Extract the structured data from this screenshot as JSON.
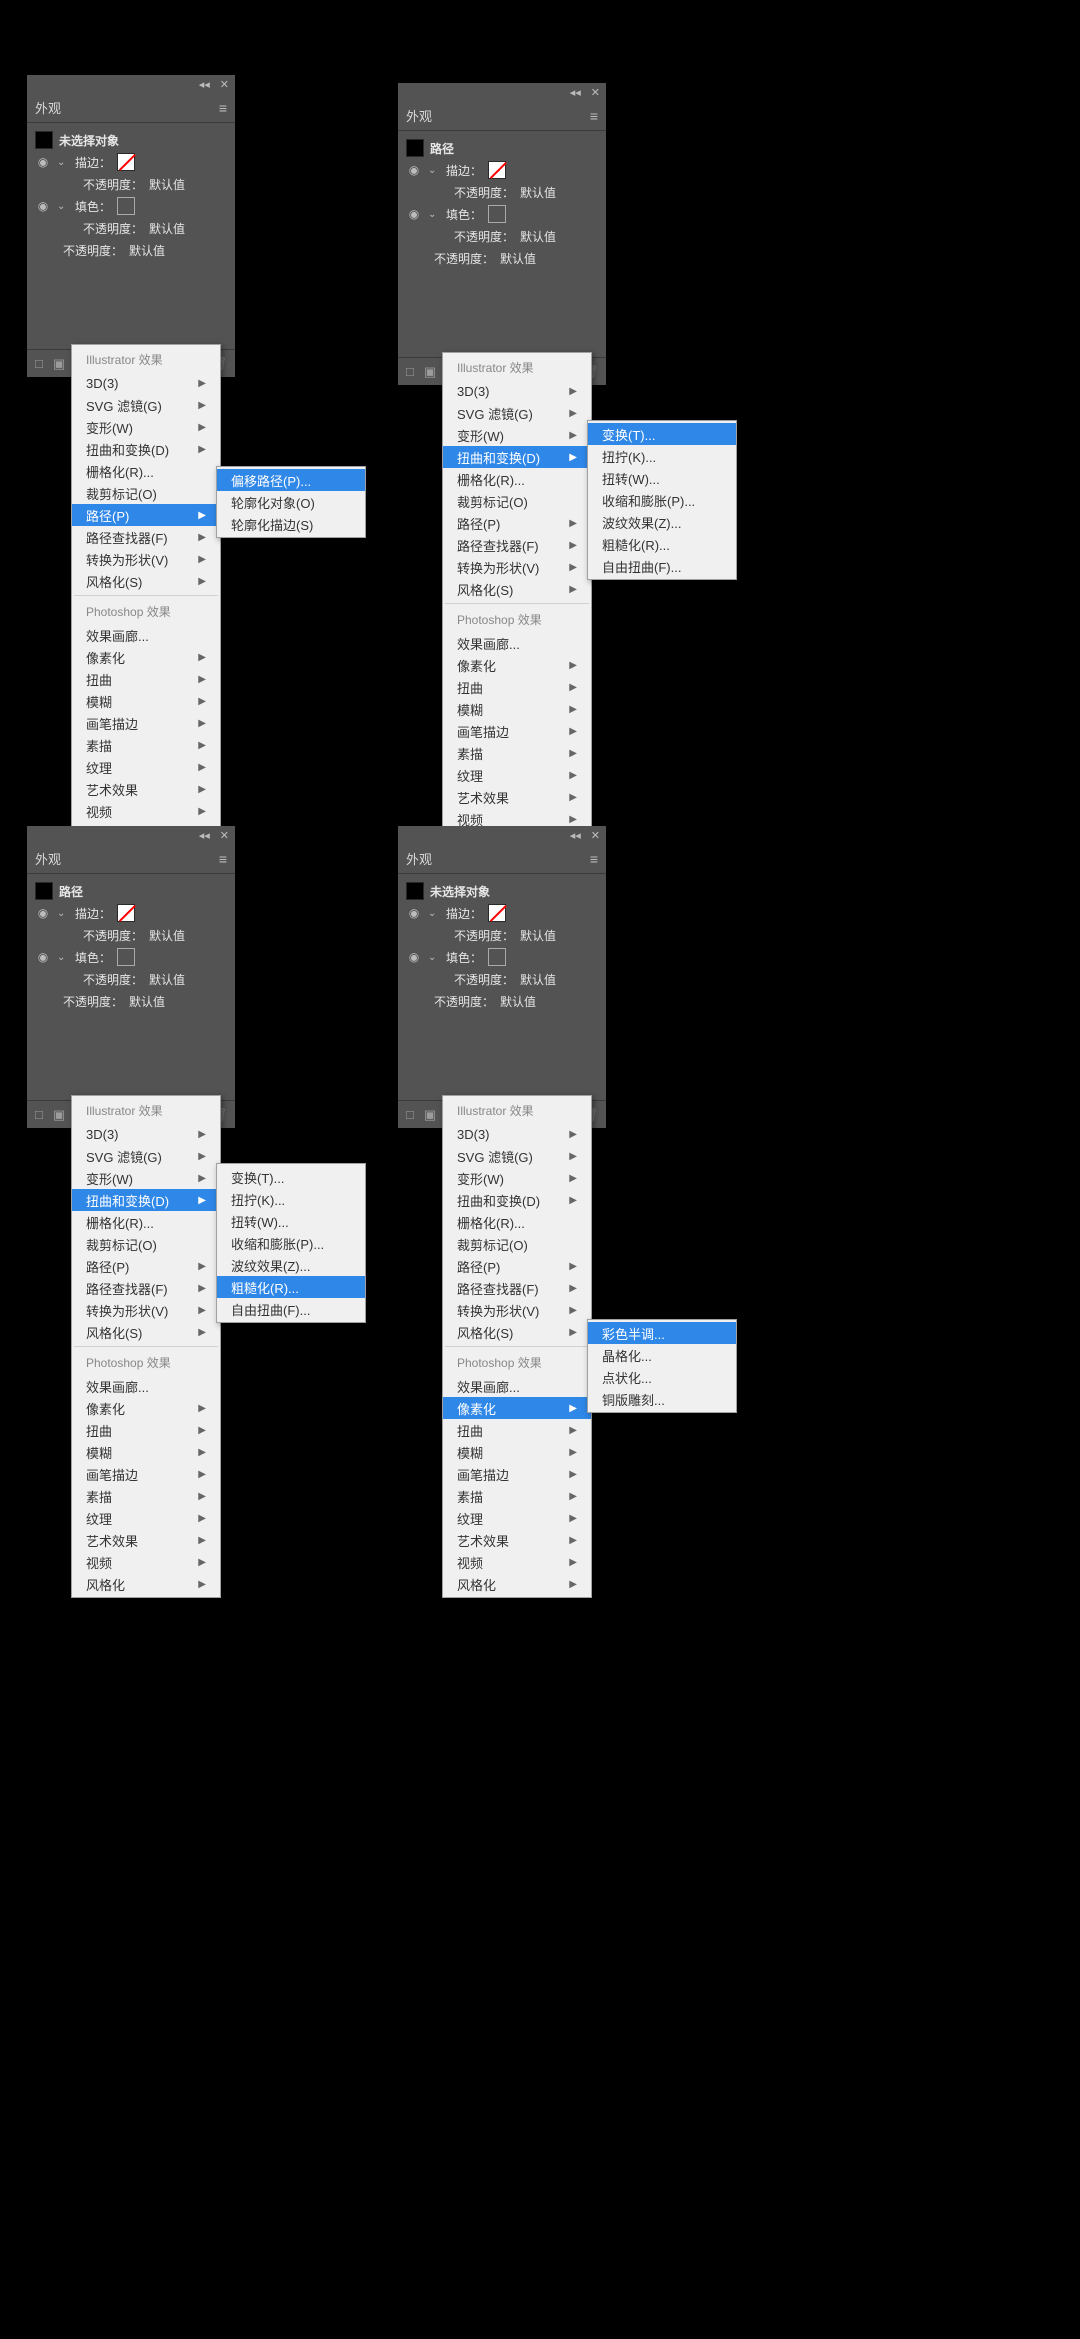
{
  "panels": {
    "p1": {
      "title": "外观",
      "selection": "未选择对象",
      "stroke_label": "描边：",
      "fill_label": "填色：",
      "opacity_label": "不透明度：",
      "default_value": "默认值"
    },
    "p2": {
      "title": "外观",
      "selection": "路径",
      "stroke_label": "描边：",
      "fill_label": "填色：",
      "opacity_label": "不透明度：",
      "default_value": "默认值"
    },
    "p3": {
      "title": "外观",
      "selection": "路径",
      "stroke_label": "描边：",
      "fill_label": "填色：",
      "opacity_label": "不透明度：",
      "default_value": "默认值"
    },
    "p4": {
      "title": "外观",
      "selection": "未选择对象",
      "stroke_label": "描边：",
      "fill_label": "填色：",
      "opacity_label": "不透明度：",
      "default_value": "默认值"
    }
  },
  "menu_sections": {
    "ill_heading": "Illustrator 效果",
    "ps_heading": "Photoshop 效果"
  },
  "ill_items_a": [
    {
      "label": "3D(3)",
      "arrow": true
    },
    {
      "label": "SVG 滤镜(G)",
      "arrow": true
    },
    {
      "label": "变形(W)",
      "arrow": true
    },
    {
      "label": "扭曲和变换(D)",
      "arrow": true
    },
    {
      "label": "栅格化(R)...",
      "arrow": false
    },
    {
      "label": "裁剪标记(O)",
      "arrow": false
    },
    {
      "label": "路径(P)",
      "arrow": true
    },
    {
      "label": "路径查找器(F)",
      "arrow": true
    },
    {
      "label": "转换为形状(V)",
      "arrow": true
    },
    {
      "label": "风格化(S)",
      "arrow": true
    }
  ],
  "ill_items_b": [
    {
      "label": "3D(3)",
      "arrow": true
    },
    {
      "label": "SVG 滤镜(G)",
      "arrow": true
    },
    {
      "label": "变形(W)",
      "arrow": true
    },
    {
      "label": "扭曲和变换(D)",
      "arrow": true
    },
    {
      "label": "栅格化(R)...",
      "arrow": false
    },
    {
      "label": "裁剪标记(O)",
      "arrow": false
    },
    {
      "label": "路径(P)",
      "arrow": true
    },
    {
      "label": "路径查找器(F)",
      "arrow": true
    },
    {
      "label": "转换为形状(V)",
      "arrow": true
    },
    {
      "label": "风格化(S)",
      "arrow": true
    }
  ],
  "ps_items": [
    {
      "label": "效果画廊...",
      "arrow": false
    },
    {
      "label": "像素化",
      "arrow": true
    },
    {
      "label": "扭曲",
      "arrow": true
    },
    {
      "label": "模糊",
      "arrow": true
    },
    {
      "label": "画笔描边",
      "arrow": true
    },
    {
      "label": "素描",
      "arrow": true
    },
    {
      "label": "纹理",
      "arrow": true
    },
    {
      "label": "艺术效果",
      "arrow": true
    },
    {
      "label": "视频",
      "arrow": true
    },
    {
      "label": "风格化",
      "arrow": true
    }
  ],
  "submenus": {
    "path": [
      "偏移路径(P)...",
      "轮廓化对象(O)",
      "轮廓化描边(S)"
    ],
    "distort": [
      "变换(T)...",
      "扭拧(K)...",
      "扭转(W)...",
      "收缩和膨胀(P)...",
      "波纹效果(Z)...",
      "粗糙化(R)...",
      "自由扭曲(F)..."
    ],
    "pixelate": [
      "彩色半调...",
      "晶格化...",
      "点状化...",
      "铜版雕刻..."
    ]
  },
  "highlights": {
    "p1_main": 6,
    "p1_sub": 0,
    "p2_main": 3,
    "p2_sub": 0,
    "p3_main": 3,
    "p3_sub": 5,
    "p4_main_ps": 1,
    "p4_sub": 0
  }
}
